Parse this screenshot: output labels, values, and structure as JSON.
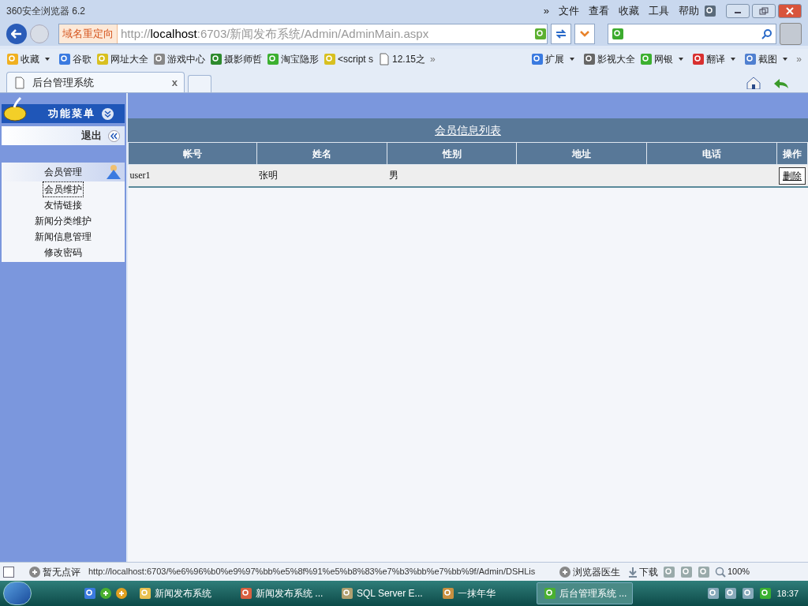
{
  "browser": {
    "title": "360安全浏览器 6.2",
    "menu": [
      "»",
      "文件",
      "查看",
      "收藏",
      "工具",
      "帮助"
    ],
    "address": {
      "badge": "域名重定向",
      "scheme": "http://",
      "host": "localhost",
      "path": ":6703/新闻发布系统/Admin/AdminMain.aspx"
    },
    "bookmarks": [
      {
        "label": "收藏",
        "kind": "dropdown"
      },
      {
        "label": "谷歌",
        "kind": "link"
      },
      {
        "label": "网址大全",
        "kind": "link"
      },
      {
        "label": "游戏中心",
        "kind": "link"
      },
      {
        "label": "摄影师哲",
        "kind": "link"
      },
      {
        "label": "淘宝隐形",
        "kind": "link"
      },
      {
        "label": "<script s",
        "kind": "link"
      },
      {
        "label": "12.15之",
        "kind": "link"
      }
    ],
    "bookmarks_more": "»",
    "tools": [
      {
        "label": "扩展",
        "kind": "dropdown"
      },
      {
        "label": "影视大全",
        "kind": "link"
      },
      {
        "label": "网银",
        "kind": "dropdown"
      },
      {
        "label": "翻译",
        "kind": "dropdown"
      },
      {
        "label": "截图",
        "kind": "dropdown"
      }
    ],
    "tools_more": "»",
    "tabs": [
      {
        "label": "后台管理系统",
        "selected": true
      }
    ],
    "tab_close": "x"
  },
  "sidebar": {
    "header": "功能菜单",
    "logout": "退出",
    "group": "会员管理",
    "items": [
      {
        "label": "会员维护",
        "focused": true
      },
      {
        "label": "友情链接",
        "focused": false
      },
      {
        "label": "新闻分类维护",
        "focused": false
      },
      {
        "label": "新闻信息管理",
        "focused": false
      },
      {
        "label": "修改密码",
        "focused": false
      }
    ]
  },
  "table": {
    "title": "会员信息列表",
    "columns": [
      "帐号",
      "姓名",
      "性别",
      "地址",
      "电话",
      "操作"
    ],
    "rows": [
      {
        "cells": [
          "user1",
          "张明",
          "男",
          "",
          ""
        ],
        "action": "删除"
      }
    ]
  },
  "status_bar": {
    "rating": "暂无点评",
    "url": "http://localhost:6703/%e6%96%b0%e9%97%bb%e5%8f%91%e5%b8%83%e7%b3%bb%e7%bb%9f/Admin/DSHLis",
    "doctor": "浏览器医生",
    "download": "下载",
    "zoom": "100%"
  },
  "taskbar": {
    "items": [
      {
        "label": "新闻发布系统",
        "selected": false
      },
      {
        "label": "新闻发布系统 ...",
        "selected": false
      },
      {
        "label": "SQL Server E...",
        "selected": false
      },
      {
        "label": "一抹年华",
        "selected": false
      },
      {
        "label": "后台管理系统 ...",
        "selected": true
      }
    ],
    "clock": "18:37"
  }
}
